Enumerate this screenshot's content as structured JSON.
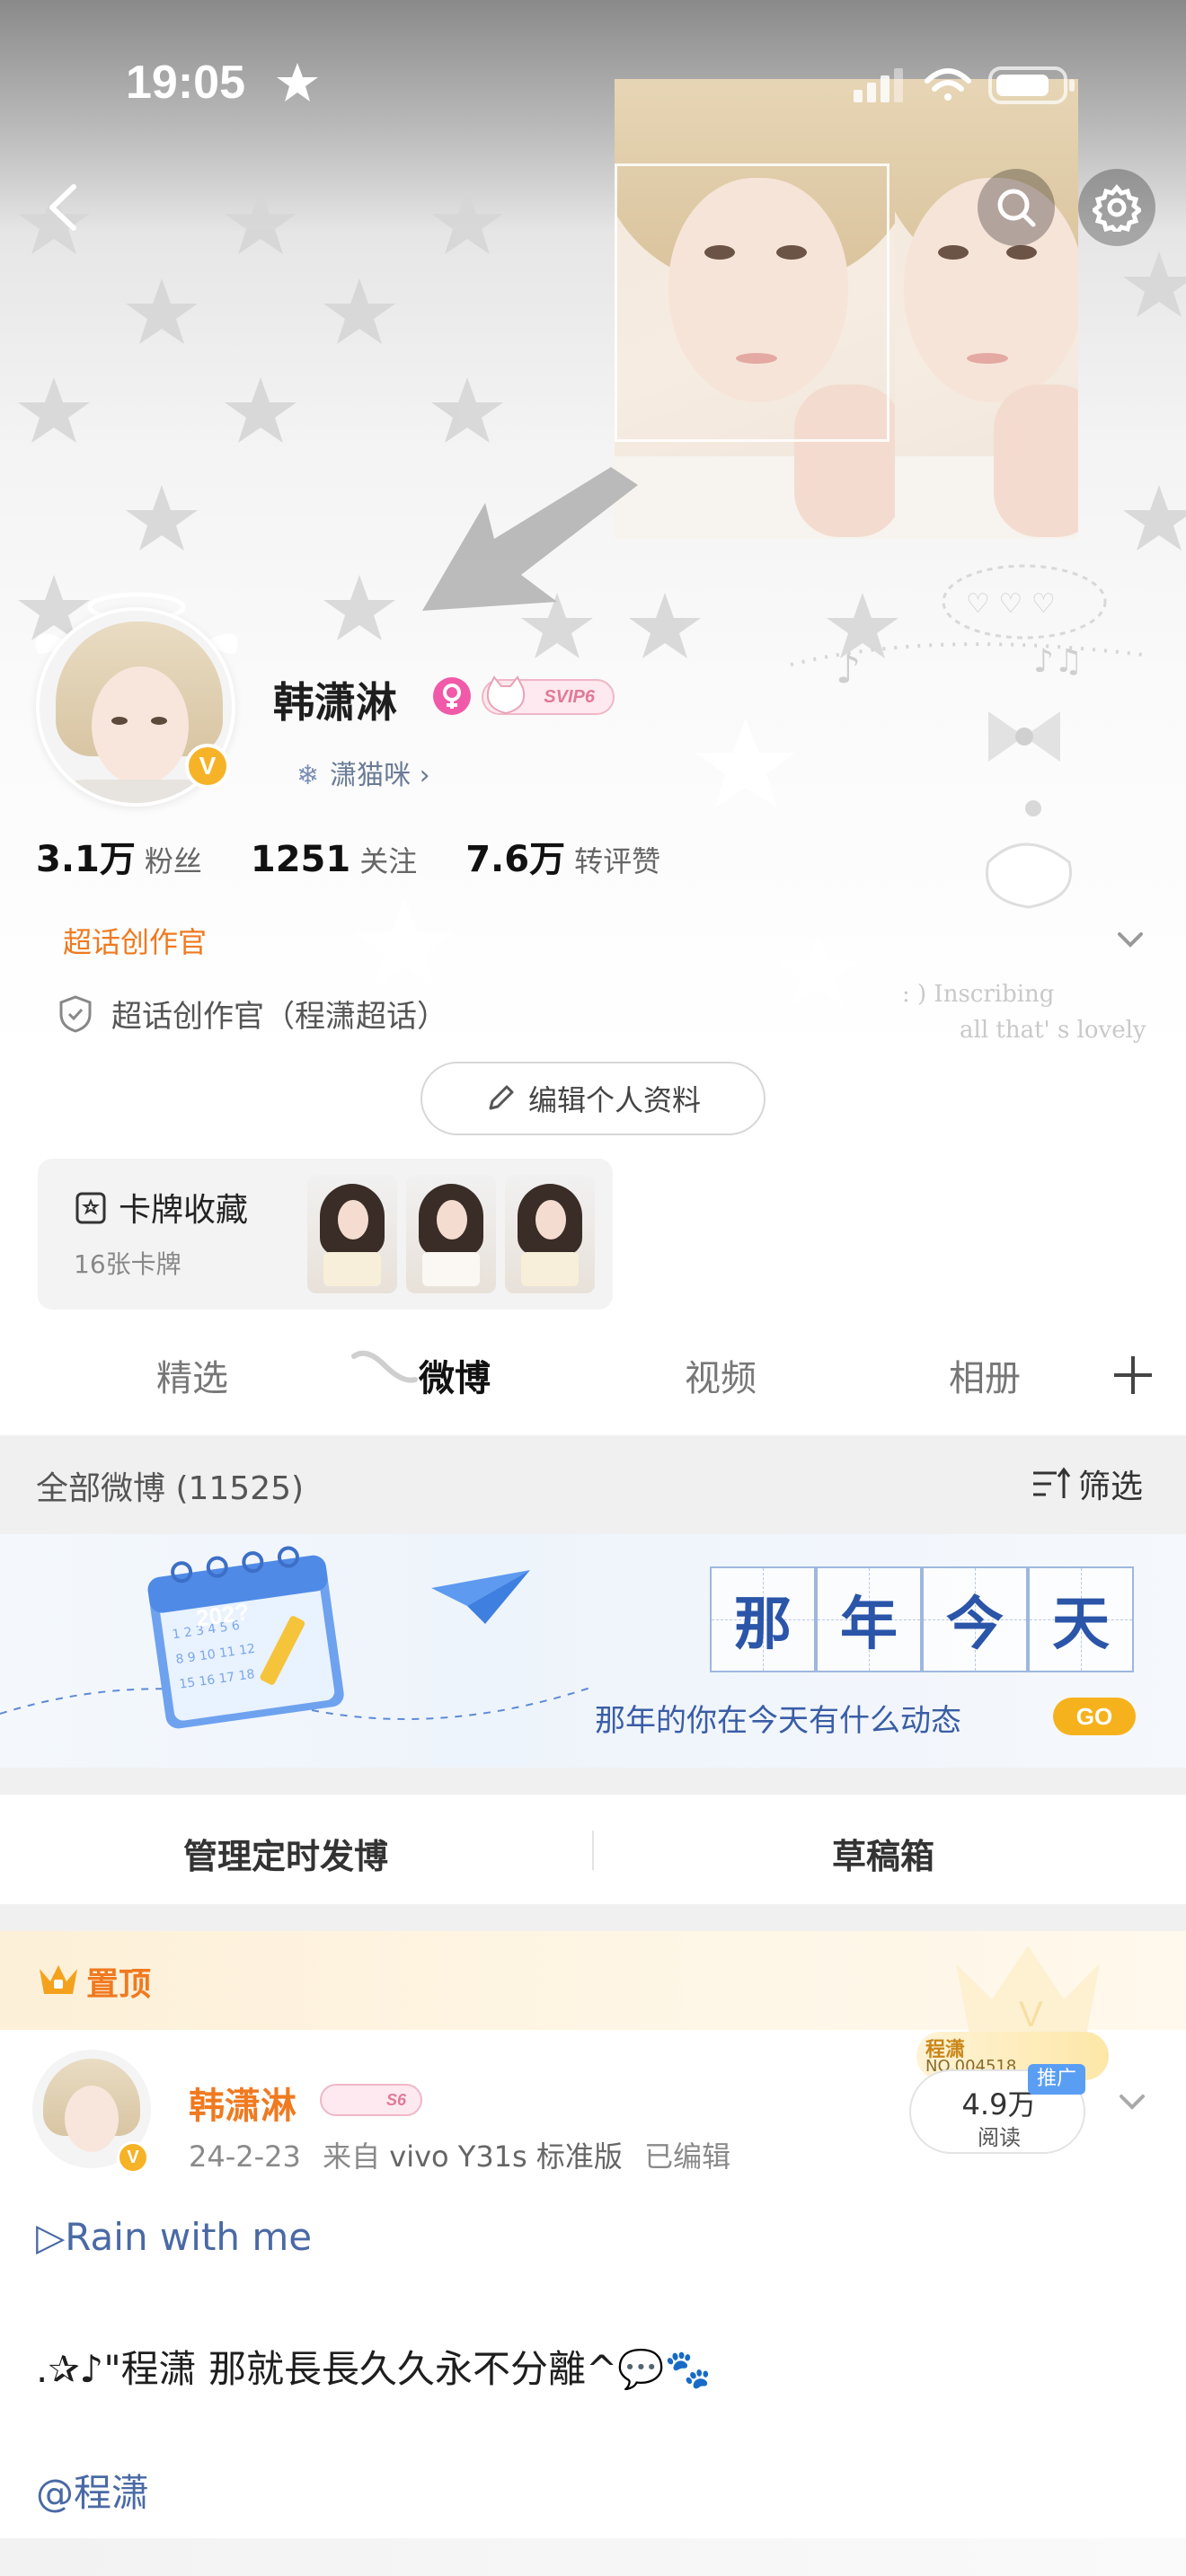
{
  "status_bar": {
    "time": "19:05"
  },
  "profile": {
    "name": "韩潇淋",
    "vip_badge": "SVIP6",
    "nickname": "潇猫咪",
    "stats": [
      {
        "value": "3.1万",
        "label": "粉丝"
      },
      {
        "value": "1251",
        "label": "关注"
      },
      {
        "value": "7.6万",
        "label": "转评赞"
      }
    ],
    "role_tag": "超话创作官",
    "role_detail": "超话创作官（程潇超话）",
    "edit_button": "编辑个人资料",
    "verified_mark": "V"
  },
  "decor": {
    "line1": ": ) Inscribing",
    "line2": "all that' s lovely"
  },
  "card_collection": {
    "title": "卡牌收藏",
    "subtitle": "16张卡牌"
  },
  "tabs": [
    {
      "label": "精选"
    },
    {
      "label": "微博"
    },
    {
      "label": "视频"
    },
    {
      "label": "相册"
    }
  ],
  "feed_header": {
    "title": "全部微博 (11525)",
    "filter": "筛选"
  },
  "banner": {
    "calendar_year": "202?",
    "chars": [
      "那",
      "年",
      "今",
      "天"
    ],
    "subtitle": "那年的你在今天有什么动态",
    "go": "GO"
  },
  "manage": {
    "scheduled": "管理定时发博",
    "drafts": "草稿箱"
  },
  "pinned": {
    "label": "置顶",
    "author": "韩潇淋",
    "author_badge": "S6",
    "date": "24-2-23",
    "source_prefix": "来自",
    "source": "vivo Y31s 标准版",
    "edited": "已编辑",
    "reads": "4.9万",
    "reads_label": "阅读",
    "promo": "推广",
    "crown_text": "程潇",
    "crown_no": "NO.004518",
    "lines": [
      "▷Rain with me",
      ".✰♪\"程潇 那就長長久久永不分離^💬🐾",
      "@程潇"
    ]
  },
  "colors": {
    "accent_orange": "#ef7a20",
    "link_blue": "#4a6aa5",
    "vip_pink": "#e1799a",
    "verified_gold": "#f6b327"
  }
}
